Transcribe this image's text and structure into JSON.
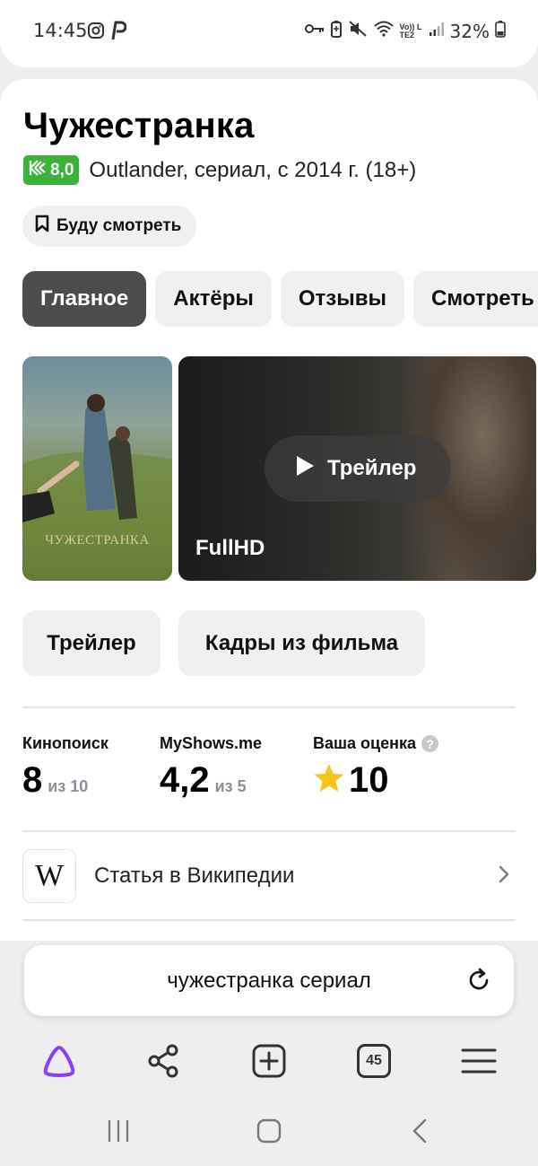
{
  "status_bar": {
    "time": "14:45",
    "battery": "32%",
    "icons": [
      "instagram-icon",
      "p-app-icon",
      "key-icon",
      "battery-saver-icon",
      "mute-icon",
      "wifi-icon",
      "volte-icon",
      "signal-icon",
      "battery-icon"
    ],
    "volte_label": "Vo)) LTE2"
  },
  "header": {
    "title": "Чужестранка",
    "kp_rating": "8,0",
    "subtitle": "Outlander, сериал, с 2014 г. (18+)",
    "watch_later": "Буду смотреть"
  },
  "tabs": [
    {
      "label": "Главное",
      "active": true
    },
    {
      "label": "Актёры",
      "active": false
    },
    {
      "label": "Отзывы",
      "active": false
    },
    {
      "label": "Смотреть",
      "active": false
    }
  ],
  "media": {
    "poster_caption": "ЧУЖЕСТРАНКА",
    "trailer_label": "Трейлер",
    "quality": "FullHD"
  },
  "chips": [
    "Трейлер",
    "Кадры из фильма"
  ],
  "scores": [
    {
      "source": "Кинопоиск",
      "value": "8",
      "scale": "из 10"
    },
    {
      "source": "MyShows.me",
      "value": "4,2",
      "scale": "из 5"
    },
    {
      "source": "Ваша оценка",
      "value": "10",
      "help": "?"
    }
  ],
  "wiki": {
    "logo": "W",
    "label": "Статья в Википедии"
  },
  "search": {
    "query": "чужестранка сериал"
  },
  "toolbar": {
    "tab_count": "45"
  },
  "colors": {
    "kp_green": "#3bb33b",
    "active_tab": "#4c4c4c",
    "alice_purple": "#8a3ffc",
    "star": "#f5c518"
  }
}
